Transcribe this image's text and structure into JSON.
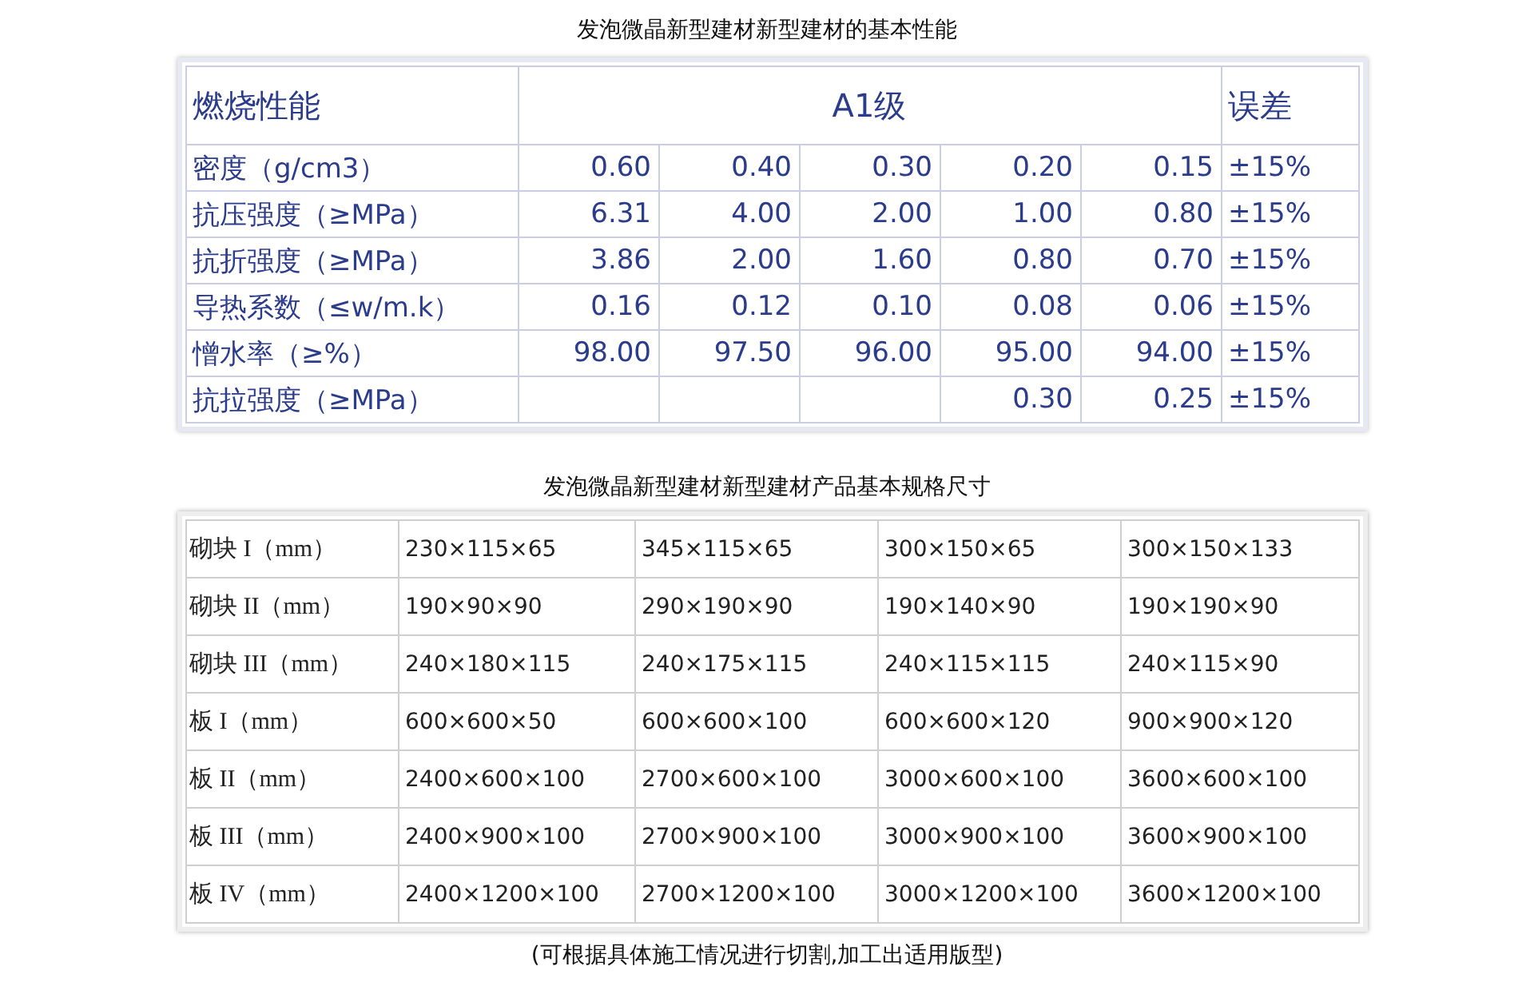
{
  "performance_table": {
    "title": "发泡微晶新型建材新型建材的基本性能",
    "header": {
      "label": "燃烧性能",
      "grade": "A1级",
      "tolerance": "误差"
    },
    "rows": [
      {
        "label": "密度（g/cm3）",
        "values": [
          "0.60",
          "0.40",
          "0.30",
          "0.20",
          "0.15"
        ],
        "tolerance": "±15%"
      },
      {
        "label": "抗压强度（≥MPa）",
        "values": [
          "6.31",
          "4.00",
          "2.00",
          "1.00",
          "0.80"
        ],
        "tolerance": "±15%"
      },
      {
        "label": "抗折强度（≥MPa）",
        "values": [
          "3.86",
          "2.00",
          "1.60",
          "0.80",
          "0.70"
        ],
        "tolerance": "±15%"
      },
      {
        "label": "导热系数（≤w/m.k）",
        "values": [
          "0.16",
          "0.12",
          "0.10",
          "0.08",
          "0.06"
        ],
        "tolerance": "±15%"
      },
      {
        "label": "憎水率（≥%）",
        "values": [
          "98.00",
          "97.50",
          "96.00",
          "95.00",
          "94.00"
        ],
        "tolerance": "±15%"
      },
      {
        "label": "抗拉强度（≥MPa）",
        "values": [
          "0.30",
          "0.25"
        ],
        "tolerance": "±15%"
      }
    ]
  },
  "size_table": {
    "title": "发泡微晶新型建材新型建材产品基本规格尺寸",
    "rows": [
      {
        "label": "砌块 I（mm）",
        "values": [
          "230×115×65",
          "345×115×65",
          "300×150×65",
          "300×150×133"
        ]
      },
      {
        "label": "砌块 II（mm）",
        "values": [
          "190×90×90",
          "290×190×90",
          "190×140×90",
          "190×190×90"
        ]
      },
      {
        "label": "砌块 III（mm）",
        "values": [
          "240×180×115",
          "240×175×115",
          "240×115×115",
          "240×115×90"
        ]
      },
      {
        "label": "板 I（mm）",
        "values": [
          "600×600×50",
          "600×600×100",
          "600×600×120",
          "900×900×120"
        ]
      },
      {
        "label": "板 II（mm）",
        "values": [
          "2400×600×100",
          "2700×600×100",
          "3000×600×100",
          "3600×600×100"
        ]
      },
      {
        "label": "板 III（mm）",
        "values": [
          "2400×900×100",
          "2700×900×100",
          "3000×900×100",
          "3600×900×100"
        ]
      },
      {
        "label": "板 IV（mm）",
        "values": [
          "2400×1200×100",
          "2700×1200×100",
          "3000×1200×100",
          "3600×1200×100"
        ]
      }
    ],
    "note": "(可根据具体施工情况进行切割,加工出适用版型)"
  }
}
